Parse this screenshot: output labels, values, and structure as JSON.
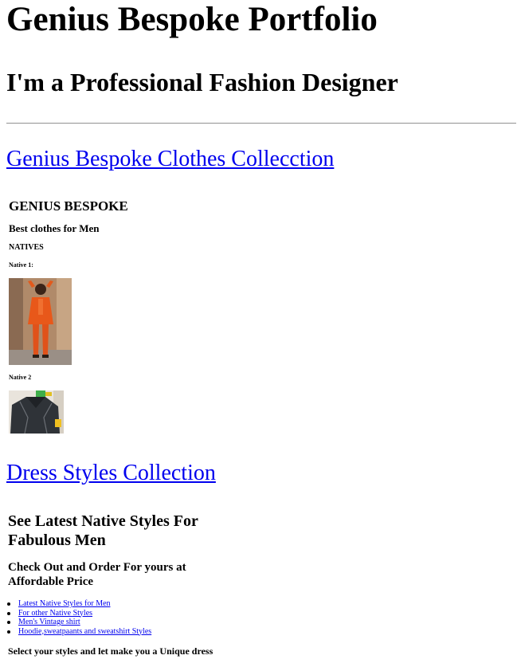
{
  "header": {
    "title": "Genius Bespoke Portfolio",
    "subtitle": "I'm a Professional Fashion Designer"
  },
  "clothes_section": {
    "link_label": "Genius Bespoke Clothes Collecction",
    "brand": "GENIUS BESPOKE",
    "tagline": "Best clothes for Men",
    "category": "NATIVES",
    "items": [
      {
        "caption": "Native 1:",
        "image_icon": "man-in-orange-native-outfit-photo"
      },
      {
        "caption": "Native 2",
        "image_icon": "dark-native-shirt-photo"
      }
    ]
  },
  "dress_section": {
    "link_label": "Dress Styles Collection",
    "heading": "See Latest Native Styles For Fabulous Men",
    "subheading": "Check Out and Order For yours at Affordable Price",
    "links": [
      "Latest Native Styles for Men",
      "For other Native Styles",
      "Men's Vintage shirt",
      "Hoodie,sweatpaants and sweatshirt Styles"
    ],
    "note": "Select your styles and let make you a Unique dress"
  },
  "colors": {
    "link": "#0000ee",
    "text": "#000000",
    "rule": "#9a9a9a"
  }
}
